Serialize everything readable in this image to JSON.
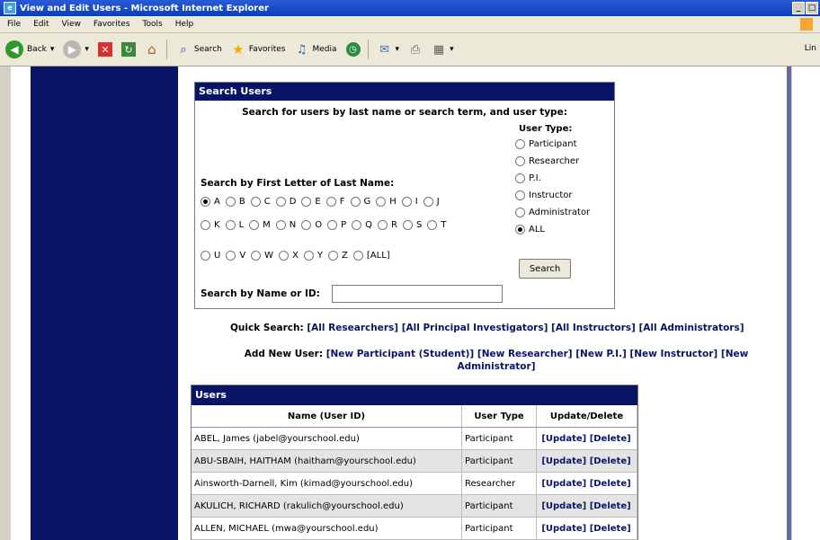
{
  "window": {
    "title": "View and Edit Users - Microsoft Internet Explorer"
  },
  "menu": [
    "File",
    "Edit",
    "View",
    "Favorites",
    "Tools",
    "Help"
  ],
  "toolbar": {
    "back": "Back",
    "search": "Search",
    "favorites": "Favorites",
    "media": "Media",
    "links": "Lin"
  },
  "search_box": {
    "header": "Search Users",
    "instruction": "Search for users by last name or search term, and user type:",
    "letters_label": "Search by First Letter of Last Name:",
    "letters_rows": [
      [
        "A",
        "B",
        "C",
        "D",
        "E",
        "F",
        "G",
        "H",
        "I",
        "J"
      ],
      [
        "K",
        "L",
        "M",
        "N",
        "O",
        "P",
        "Q",
        "R",
        "S",
        "T"
      ],
      [
        "U",
        "V",
        "W",
        "X",
        "Y",
        "Z",
        "[ALL]"
      ]
    ],
    "selected_letter": "A",
    "user_type_title": "User Type:",
    "user_types": [
      "Participant",
      "Researcher",
      "P.I.",
      "Instructor",
      "Administrator",
      "ALL"
    ],
    "selected_user_type": "ALL",
    "search_button": "Search",
    "name_label": "Search by Name or ID:",
    "name_value": ""
  },
  "quick_search": {
    "label": "Quick Search:",
    "links": [
      "[All Researchers]",
      "[All Principal Investigators]",
      "[All Instructors]",
      "[All Administrators]"
    ]
  },
  "add_new": {
    "label": "Add New User:",
    "links": [
      "[New Participant (Student)]",
      "[New Researcher]",
      "[New P.I.]",
      "[New Instructor]",
      "[New Administrator]"
    ]
  },
  "users": {
    "header": "Users",
    "columns": [
      "Name (User ID)",
      "User Type",
      "Update/Delete"
    ],
    "update_label": "[Update]",
    "delete_label": "[Delete]",
    "rows": [
      {
        "name": "ABEL, James (jabel@yourschool.edu)",
        "type": "Participant"
      },
      {
        "name": "ABU-SBAIH, HAITHAM (haitham@yourschool.edu)",
        "type": "Participant"
      },
      {
        "name": "Ainsworth-Darnell, Kim (kimad@yourschool.edu)",
        "type": "Researcher"
      },
      {
        "name": "AKULICH, RICHARD (rakulich@yourschool.edu)",
        "type": "Participant"
      },
      {
        "name": "ALLEN, MICHAEL (mwa@yourschool.edu)",
        "type": "Participant"
      }
    ]
  }
}
